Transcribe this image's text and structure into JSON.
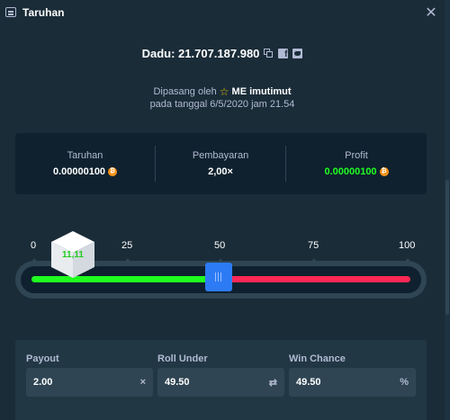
{
  "window": {
    "title": "Taruhan",
    "close_glyph": "✕",
    "title_icon": "receipt-icon"
  },
  "dice": {
    "text": "Dadu: 21.707.187.980"
  },
  "placed": {
    "prefix": "Dipasang oleh",
    "user": "ME imutimut",
    "date_line": "pada tanggal 6/5/2020 jam 21.54"
  },
  "stats": {
    "wager_label": "Taruhan",
    "wager_value": "0.00000100",
    "payout_label": "Pembayaran",
    "payout_value": "2,00×",
    "profit_label": "Profit",
    "profit_value": "0.00000100"
  },
  "slider": {
    "ticks": [
      "0",
      "25",
      "50",
      "75",
      "100"
    ],
    "result": "11,11",
    "roll_under_value": 49.5,
    "colors": {
      "win": "#1fff20",
      "lose": "#ff2855",
      "handle": "#2d7bf4"
    }
  },
  "fields": {
    "payout_label": "Payout",
    "payout_value": "2.00",
    "payout_suffix": "×",
    "roll_under_label": "Roll Under",
    "roll_under_value": "49.50",
    "roll_under_suffix": "⇄",
    "win_chance_label": "Win Chance",
    "win_chance_value": "49.50",
    "win_chance_suffix": "%"
  },
  "colors": {
    "bg": "#1a2c38",
    "panel": "#0f212e",
    "accent": "#2d7bf4",
    "profit": "#1fff20"
  }
}
